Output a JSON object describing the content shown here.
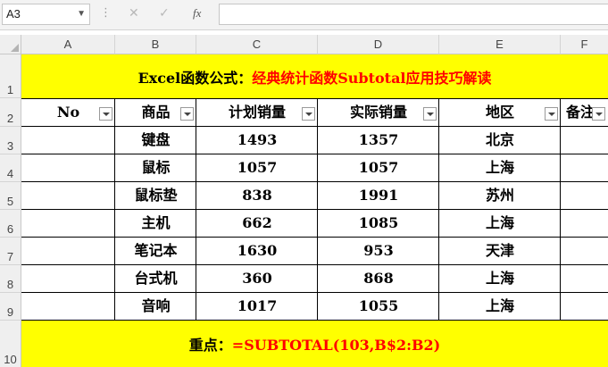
{
  "formula_bar": {
    "name_box": "A3",
    "fx_label": "fx",
    "formula": ""
  },
  "columns": [
    "A",
    "B",
    "C",
    "D",
    "E",
    "F"
  ],
  "rows": [
    "1",
    "2",
    "3",
    "4",
    "5",
    "6",
    "7",
    "8",
    "9",
    "10"
  ],
  "title": {
    "black": "Excel函数公式：",
    "red": "经典统计函数Subtotal应用技巧解读"
  },
  "headers": [
    "No",
    "商品",
    "计划销量",
    "实际销量",
    "地区",
    "备注"
  ],
  "table_rows": [
    {
      "no": "",
      "product": "键盘",
      "plan": "1493",
      "actual": "1357",
      "region": "北京",
      "note": ""
    },
    {
      "no": "",
      "product": "鼠标",
      "plan": "1057",
      "actual": "1057",
      "region": "上海",
      "note": ""
    },
    {
      "no": "",
      "product": "鼠标垫",
      "plan": "838",
      "actual": "1991",
      "region": "苏州",
      "note": ""
    },
    {
      "no": "",
      "product": "主机",
      "plan": "662",
      "actual": "1085",
      "region": "上海",
      "note": ""
    },
    {
      "no": "",
      "product": "笔记本",
      "plan": "1630",
      "actual": "953",
      "region": "天津",
      "note": ""
    },
    {
      "no": "",
      "product": "台式机",
      "plan": "360",
      "actual": "868",
      "region": "上海",
      "note": ""
    },
    {
      "no": "",
      "product": "音响",
      "plan": "1017",
      "actual": "1055",
      "region": "上海",
      "note": ""
    }
  ],
  "footer": {
    "black": "重点：",
    "red": "=SUBTOTAL(103,B$2:B2)"
  }
}
